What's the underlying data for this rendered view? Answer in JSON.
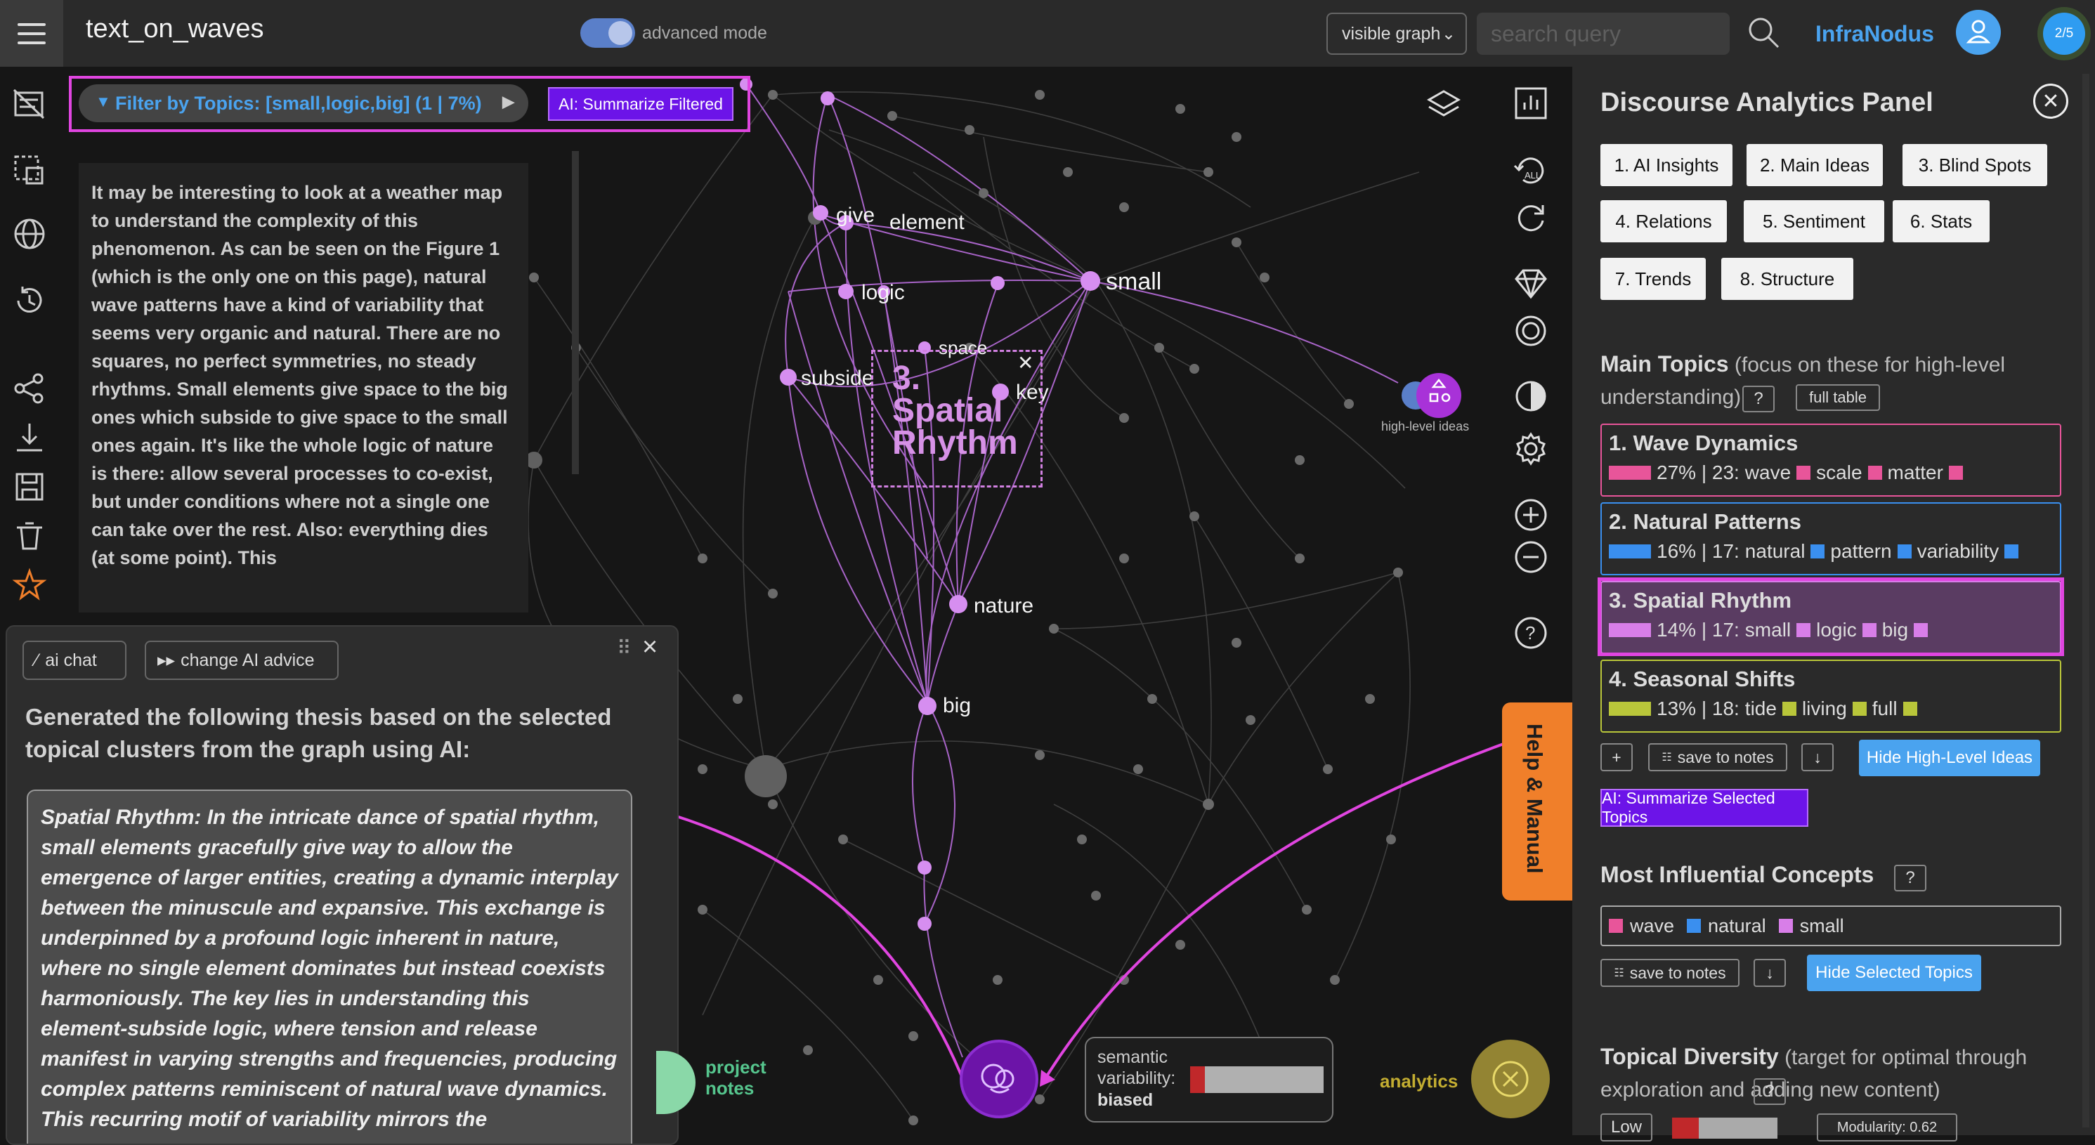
{
  "app": {
    "title": "text_on_waves",
    "advanced_mode_label": "advanced mode",
    "advanced_mode_on": true,
    "graph_select_value": "visible graph",
    "search_placeholder": "search query",
    "brand": "InfraNodus",
    "progress": "2/5"
  },
  "filter": {
    "label": "Filter by Topics: [small,logic,big] (1 | 7%)",
    "summarize_label": "AI: Summarize Filtered"
  },
  "text_panel": {
    "content": "It may be interesting to look at a weather map to understand the complexity of this phenomenon. As can be seen on the Figure 1 (which is the only one on this page), natural wave patterns have a kind of variability that seems very organic and natural. There are no squares, no perfect symmetries, no steady rhythms. Small elements give space to the big ones which subside to give space to the small ones again. It's like the whole logic of nature is there: allow several processes to co-exist, but under conditions where not a single one can take over the rest. Also: everything dies (at some point). This"
  },
  "ai_panel": {
    "chat_label": "ai chat",
    "advice_label": "change AI advice",
    "heading": "Generated the following thesis based on the selected topical clusters from the graph using AI:",
    "result": "Spatial Rhythm: In the intricate dance of spatial rhythm, small elements gracefully give way to allow the emergence of larger entities, creating a dynamic interplay between the minuscule and expansive. This exchange is underpinned by a profound logic inherent in nature, where no single element dominates but instead coexists harmoniously. The key lies in understanding this element-subside logic, where tension and release manifest in varying strengths and frequencies, producing complex patterns reminiscent of natural wave dynamics. This recurring motif of variability mirrors the"
  },
  "graph": {
    "nodes": {
      "give": "give",
      "element": "element",
      "logic": "logic",
      "small": "small",
      "space": "space",
      "subside": "subside",
      "key": "key",
      "nature": "nature",
      "big": "big"
    },
    "cluster_label": "3. Spatial Rhythm",
    "high_level_label": "high-level ideas",
    "help_label": "Help & Manual",
    "notes_label": "project notes",
    "variability_label": "semantic variability:",
    "variability_value": "biased",
    "variability_level": 0.11,
    "analytics_label": "analytics"
  },
  "panel": {
    "title": "Discourse Analytics Panel",
    "tabs": [
      "1. AI Insights",
      "2. Main Ideas",
      "3. Blind Spots",
      "4. Relations",
      "5. Sentiment",
      "6. Stats",
      "7. Trends",
      "8. Structure"
    ],
    "main_topics_title": "Main Topics",
    "main_topics_note": "(focus on these for high-level understanding)",
    "help_q": "?",
    "full_table": "full table",
    "topics": [
      {
        "title": "1. Wave Dynamics",
        "meta": "27% | 23:",
        "words": [
          "wave",
          "scale",
          "matter"
        ],
        "color": "#e8559a",
        "percent": 27
      },
      {
        "title": "2. Natural Patterns",
        "meta": "16% | 17:",
        "words": [
          "natural",
          "pattern",
          "variability"
        ],
        "color": "#3a8fef",
        "percent": 16
      },
      {
        "title": "3. Spatial Rhythm",
        "meta": "14% | 17:",
        "words": [
          "small",
          "logic",
          "big"
        ],
        "color": "#d87ee8",
        "percent": 14
      },
      {
        "title": "4. Seasonal Shifts",
        "meta": "13% | 18:",
        "words": [
          "tide",
          "living",
          "full"
        ],
        "color": "#b9c63a",
        "percent": 13
      }
    ],
    "plus": "+",
    "save_to_notes": "save to notes",
    "download": "↓",
    "hide_high_level": "Hide High-Level Ideas",
    "summarize_topics": "AI: Summarize Selected Topics",
    "influential_title": "Most Influential Concepts",
    "influential": [
      {
        "word": "wave",
        "color": "#e8559a"
      },
      {
        "word": "natural",
        "color": "#3a8fef"
      },
      {
        "word": "small",
        "color": "#d87ee8"
      }
    ],
    "hide_selected": "Hide Selected Topics",
    "diversity_title": "Topical Diversity",
    "diversity_note": "(target for optimal through exploration and adding new content)",
    "diversity_value": "Low",
    "modularity": "Modularity: 0.62"
  }
}
